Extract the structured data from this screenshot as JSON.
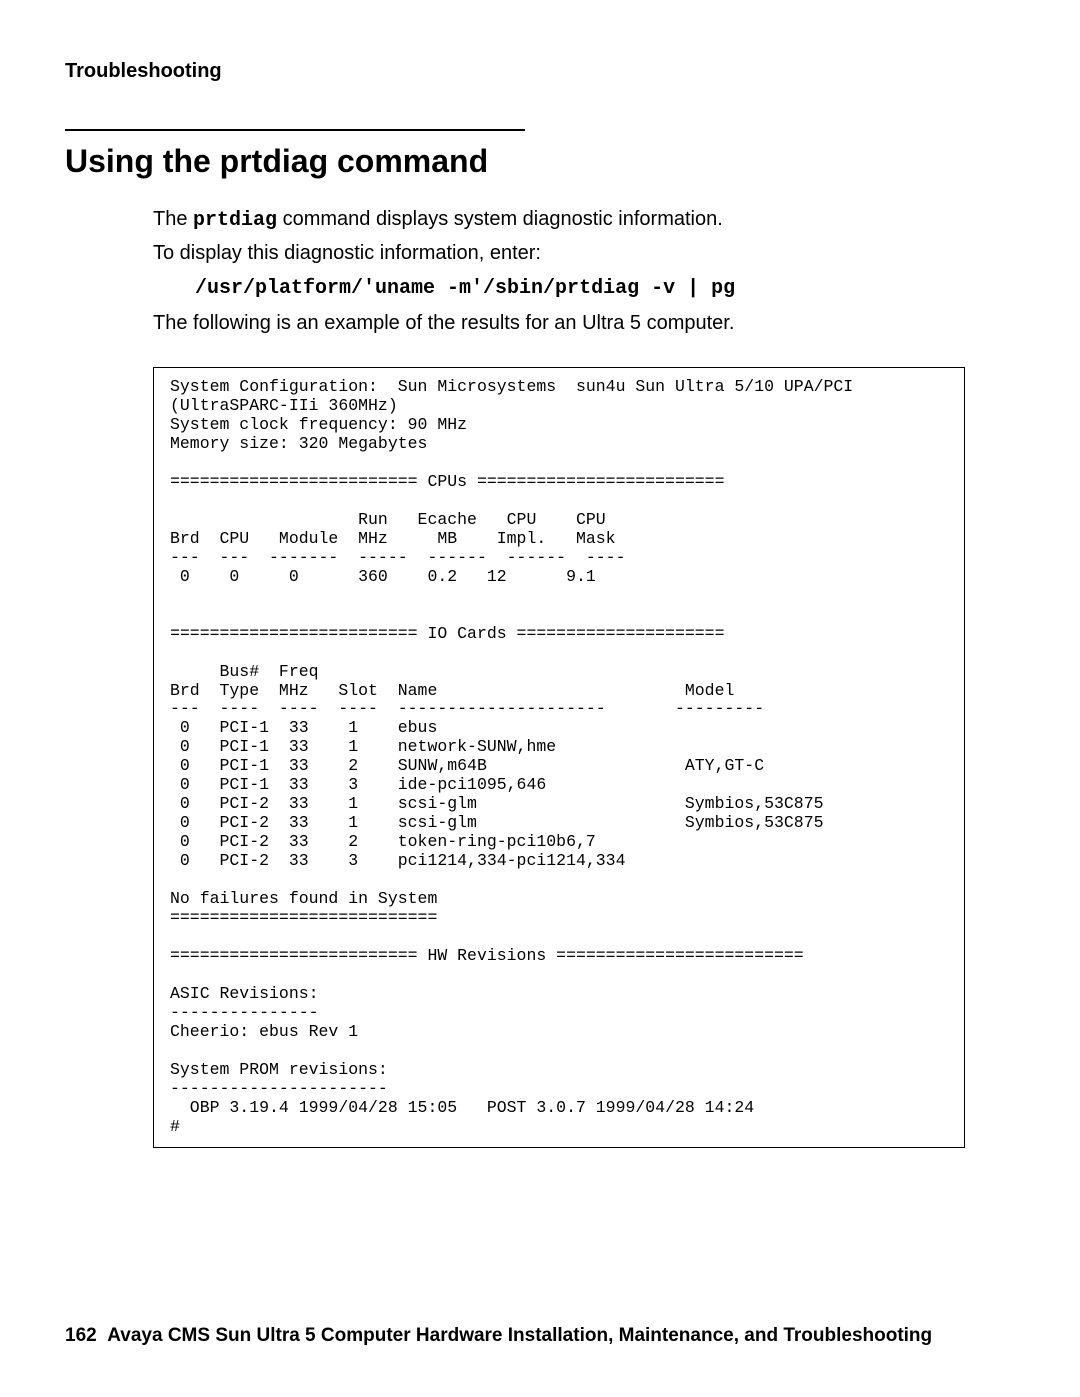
{
  "header": "Troubleshooting",
  "section_title": "Using the prtdiag command",
  "p1_a": "The ",
  "p1_cmd": "prtdiag",
  "p1_b": " command displays system diagnostic information.",
  "p2": "To display this diagnostic information, enter:",
  "cmd": "/usr/platform/'uname -m'/sbin/prtdiag -v | pg",
  "p3": "The following is an example of the results for an Ultra 5 computer.",
  "pre": "System Configuration:  Sun Microsystems  sun4u Sun Ultra 5/10 UPA/PCI\n(UltraSPARC-IIi 360MHz)\nSystem clock frequency: 90 MHz\nMemory size: 320 Megabytes\n\n========================= CPUs =========================\n\n                   Run   Ecache   CPU    CPU\nBrd  CPU   Module  MHz     MB    Impl.   Mask\n---  ---  -------  -----  ------  ------  ----\n 0    0     0      360    0.2   12      9.1\n\n\n========================= IO Cards =====================\n\n     Bus#  Freq\nBrd  Type  MHz   Slot  Name                         Model\n---  ----  ----  ----  ---------------------       ---------\n 0   PCI-1  33    1    ebus\n 0   PCI-1  33    1    network-SUNW,hme\n 0   PCI-1  33    2    SUNW,m64B                    ATY,GT-C\n 0   PCI-1  33    3    ide-pci1095,646\n 0   PCI-2  33    1    scsi-glm                     Symbios,53C875\n 0   PCI-2  33    1    scsi-glm                     Symbios,53C875\n 0   PCI-2  33    2    token-ring-pci10b6,7\n 0   PCI-2  33    3    pci1214,334-pci1214,334\n\nNo failures found in System\n===========================\n\n========================= HW Revisions =========================\n\nASIC Revisions:\n---------------\nCheerio: ebus Rev 1\n\nSystem PROM revisions:\n----------------------\n  OBP 3.19.4 1999/04/28 15:05   POST 3.0.7 1999/04/28 14:24\n#",
  "footer_page": "162",
  "footer_text": "Avaya CMS Sun Ultra 5 Computer Hardware Installation, Maintenance, and Troubleshooting"
}
